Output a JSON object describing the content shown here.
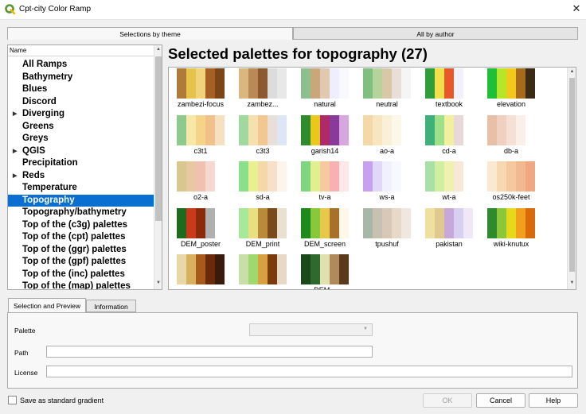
{
  "window": {
    "title": "Cpt-city Color Ramp",
    "close_glyph": "✕"
  },
  "top_tabs": [
    {
      "label": "Selections by theme"
    },
    {
      "label": "All by author"
    }
  ],
  "tree": {
    "header": "Name",
    "items": [
      {
        "label": "All Ramps",
        "expandable": false,
        "selected": false
      },
      {
        "label": "Bathymetry",
        "expandable": false,
        "selected": false
      },
      {
        "label": "Blues",
        "expandable": false,
        "selected": false
      },
      {
        "label": "Discord",
        "expandable": false,
        "selected": false
      },
      {
        "label": "Diverging",
        "expandable": true,
        "selected": false
      },
      {
        "label": "Greens",
        "expandable": false,
        "selected": false
      },
      {
        "label": "Greys",
        "expandable": false,
        "selected": false
      },
      {
        "label": "QGIS",
        "expandable": true,
        "selected": false
      },
      {
        "label": "Precipitation",
        "expandable": false,
        "selected": false
      },
      {
        "label": "Reds",
        "expandable": true,
        "selected": false
      },
      {
        "label": "Temperature",
        "expandable": false,
        "selected": false
      },
      {
        "label": "Topography",
        "expandable": false,
        "selected": true
      },
      {
        "label": "Topography/bathymetry",
        "expandable": false,
        "selected": false
      },
      {
        "label": "Top of the (c3g) palettes",
        "expandable": false,
        "selected": false
      },
      {
        "label": "Top of the (cpt) palettes",
        "expandable": false,
        "selected": false
      },
      {
        "label": "Top of the (ggr) palettes",
        "expandable": false,
        "selected": false
      },
      {
        "label": "Top of the (gpf) palettes",
        "expandable": false,
        "selected": false
      },
      {
        "label": "Top of the (inc) palettes",
        "expandable": false,
        "selected": false
      },
      {
        "label": "Top of the (map) palettes",
        "expandable": false,
        "selected": false
      }
    ]
  },
  "heading": "Selected palettes for topography (27)",
  "palettes": [
    {
      "label": "zambezi-focus",
      "colors": [
        "#b07a3a",
        "#e6c34a",
        "#f2d27a",
        "#a65f24",
        "#7d4418"
      ]
    },
    {
      "label": "zambez...",
      "colors": [
        "#d9b77e",
        "#b98a55",
        "#8c5a2e",
        "#dcdcdc",
        "#e8e8e8"
      ]
    },
    {
      "label": "natural",
      "colors": [
        "#8fbf8f",
        "#c9a77a",
        "#e0c9b0",
        "#eeeeff",
        "#f8f8ff"
      ]
    },
    {
      "label": "neutral",
      "colors": [
        "#7fbf7f",
        "#b5d49b",
        "#d8c8a8",
        "#e8e0d8",
        "#f5f5f5"
      ]
    },
    {
      "label": "textbook",
      "colors": [
        "#2e9e3a",
        "#f2e04a",
        "#e65a2a",
        "#f0f0ff",
        "#ffffff"
      ]
    },
    {
      "label": "elevation",
      "colors": [
        "#1fbf3a",
        "#b6e62a",
        "#f2c81a",
        "#a66a1a",
        "#3b2a14"
      ]
    },
    {
      "label": "c3t1",
      "colors": [
        "#8ec98e",
        "#f8e8a8",
        "#f5d48a",
        "#f2c08a",
        "#f7e0c0"
      ]
    },
    {
      "label": "c3t3",
      "colors": [
        "#a0d8a0",
        "#f5e0b0",
        "#f2c890",
        "#e8e0d8",
        "#dde6f5"
      ]
    },
    {
      "label": "garish14",
      "colors": [
        "#2e8b2e",
        "#e8c81a",
        "#b02a6a",
        "#8a3a9a",
        "#d7a8e0"
      ]
    },
    {
      "label": "ao-a",
      "colors": [
        "#f5d8a8",
        "#f8e6c0",
        "#faf0d8",
        "#fdf7ea",
        "#ffffff"
      ]
    },
    {
      "label": "cd-a",
      "colors": [
        "#3fb07a",
        "#9ee08a",
        "#f2f0a0",
        "#e8d8d8",
        "#ffffff"
      ]
    },
    {
      "label": "db-a",
      "colors": [
        "#e8c0a8",
        "#f0d0c0",
        "#f6e0d6",
        "#fbefe9",
        "#ffffff"
      ]
    },
    {
      "label": "o2-a",
      "colors": [
        "#d8c890",
        "#e8c8a0",
        "#f0c0b0",
        "#f7d8d0",
        "#ffffff"
      ]
    },
    {
      "label": "sd-a",
      "colors": [
        "#8ae08a",
        "#e8f090",
        "#f5d8a8",
        "#f8e0c8",
        "#fdf5ec"
      ]
    },
    {
      "label": "tv-a",
      "colors": [
        "#7fd67f",
        "#e0f090",
        "#f8c8a0",
        "#f8b0b0",
        "#ffe8e8"
      ]
    },
    {
      "label": "ws-a",
      "colors": [
        "#c8a0f0",
        "#e0d8f8",
        "#f0f0ff",
        "#f8f8ff",
        "#ffffff"
      ]
    },
    {
      "label": "wt-a",
      "colors": [
        "#a8e0a8",
        "#d0f0a0",
        "#f0f0b0",
        "#f8e8d8",
        "#ffffff"
      ]
    },
    {
      "label": "os250k-feet",
      "colors": [
        "#fbe8d0",
        "#f8d8b0",
        "#f5c8a0",
        "#f2b890",
        "#f0a880"
      ]
    },
    {
      "label": "DEM_poster",
      "colors": [
        "#1e6a1e",
        "#c83a1a",
        "#8a2a0a",
        "#b0b0b0",
        "#ffffff"
      ]
    },
    {
      "label": "DEM_print",
      "colors": [
        "#a8e89a",
        "#e8e080",
        "#b88a3a",
        "#7a4a1a",
        "#e8e0d0"
      ]
    },
    {
      "label": "DEM_screen",
      "colors": [
        "#1e8a1e",
        "#88c83a",
        "#e8c84a",
        "#a8702a",
        "#fff8e8"
      ]
    },
    {
      "label": "tpushuf",
      "colors": [
        "#a8b8a8",
        "#c8c0b0",
        "#d8c8b8",
        "#e8d8c8",
        "#f0e8e0"
      ]
    },
    {
      "label": "pakistan",
      "colors": [
        "#f0e0a0",
        "#e0c890",
        "#c8a8d8",
        "#d8d0f0",
        "#f0e8f8"
      ]
    },
    {
      "label": "wiki-knutux",
      "colors": [
        "#2e8a2e",
        "#8ac83a",
        "#e8d81a",
        "#f0a01a",
        "#d86a0a"
      ]
    },
    {
      "label": "",
      "colors": [
        "#e8d8a8",
        "#d8b060",
        "#a85a1a",
        "#6a2a0a",
        "#3a1a0a"
      ]
    },
    {
      "label": "",
      "colors": [
        "#c8e0a8",
        "#a0d870",
        "#d8a040",
        "#7a3a0a",
        "#e8d8c8"
      ]
    },
    {
      "label": "DEM...",
      "colors": [
        "#1a4a1a",
        "#2e6a2e",
        "#e0e0b0",
        "#b08a5a",
        "#5a3a1a"
      ]
    }
  ],
  "bottom_tabs": [
    {
      "label": "Selection and Preview"
    },
    {
      "label": "Information"
    }
  ],
  "form": {
    "palette_label": "Palette",
    "path_label": "Path",
    "license_label": "License",
    "path_value": "",
    "license_value": "",
    "palette_value": ""
  },
  "footer": {
    "checkbox_label": "Save as standard gradient",
    "ok_label": "OK",
    "cancel_label": "Cancel",
    "help_label": "Help"
  }
}
